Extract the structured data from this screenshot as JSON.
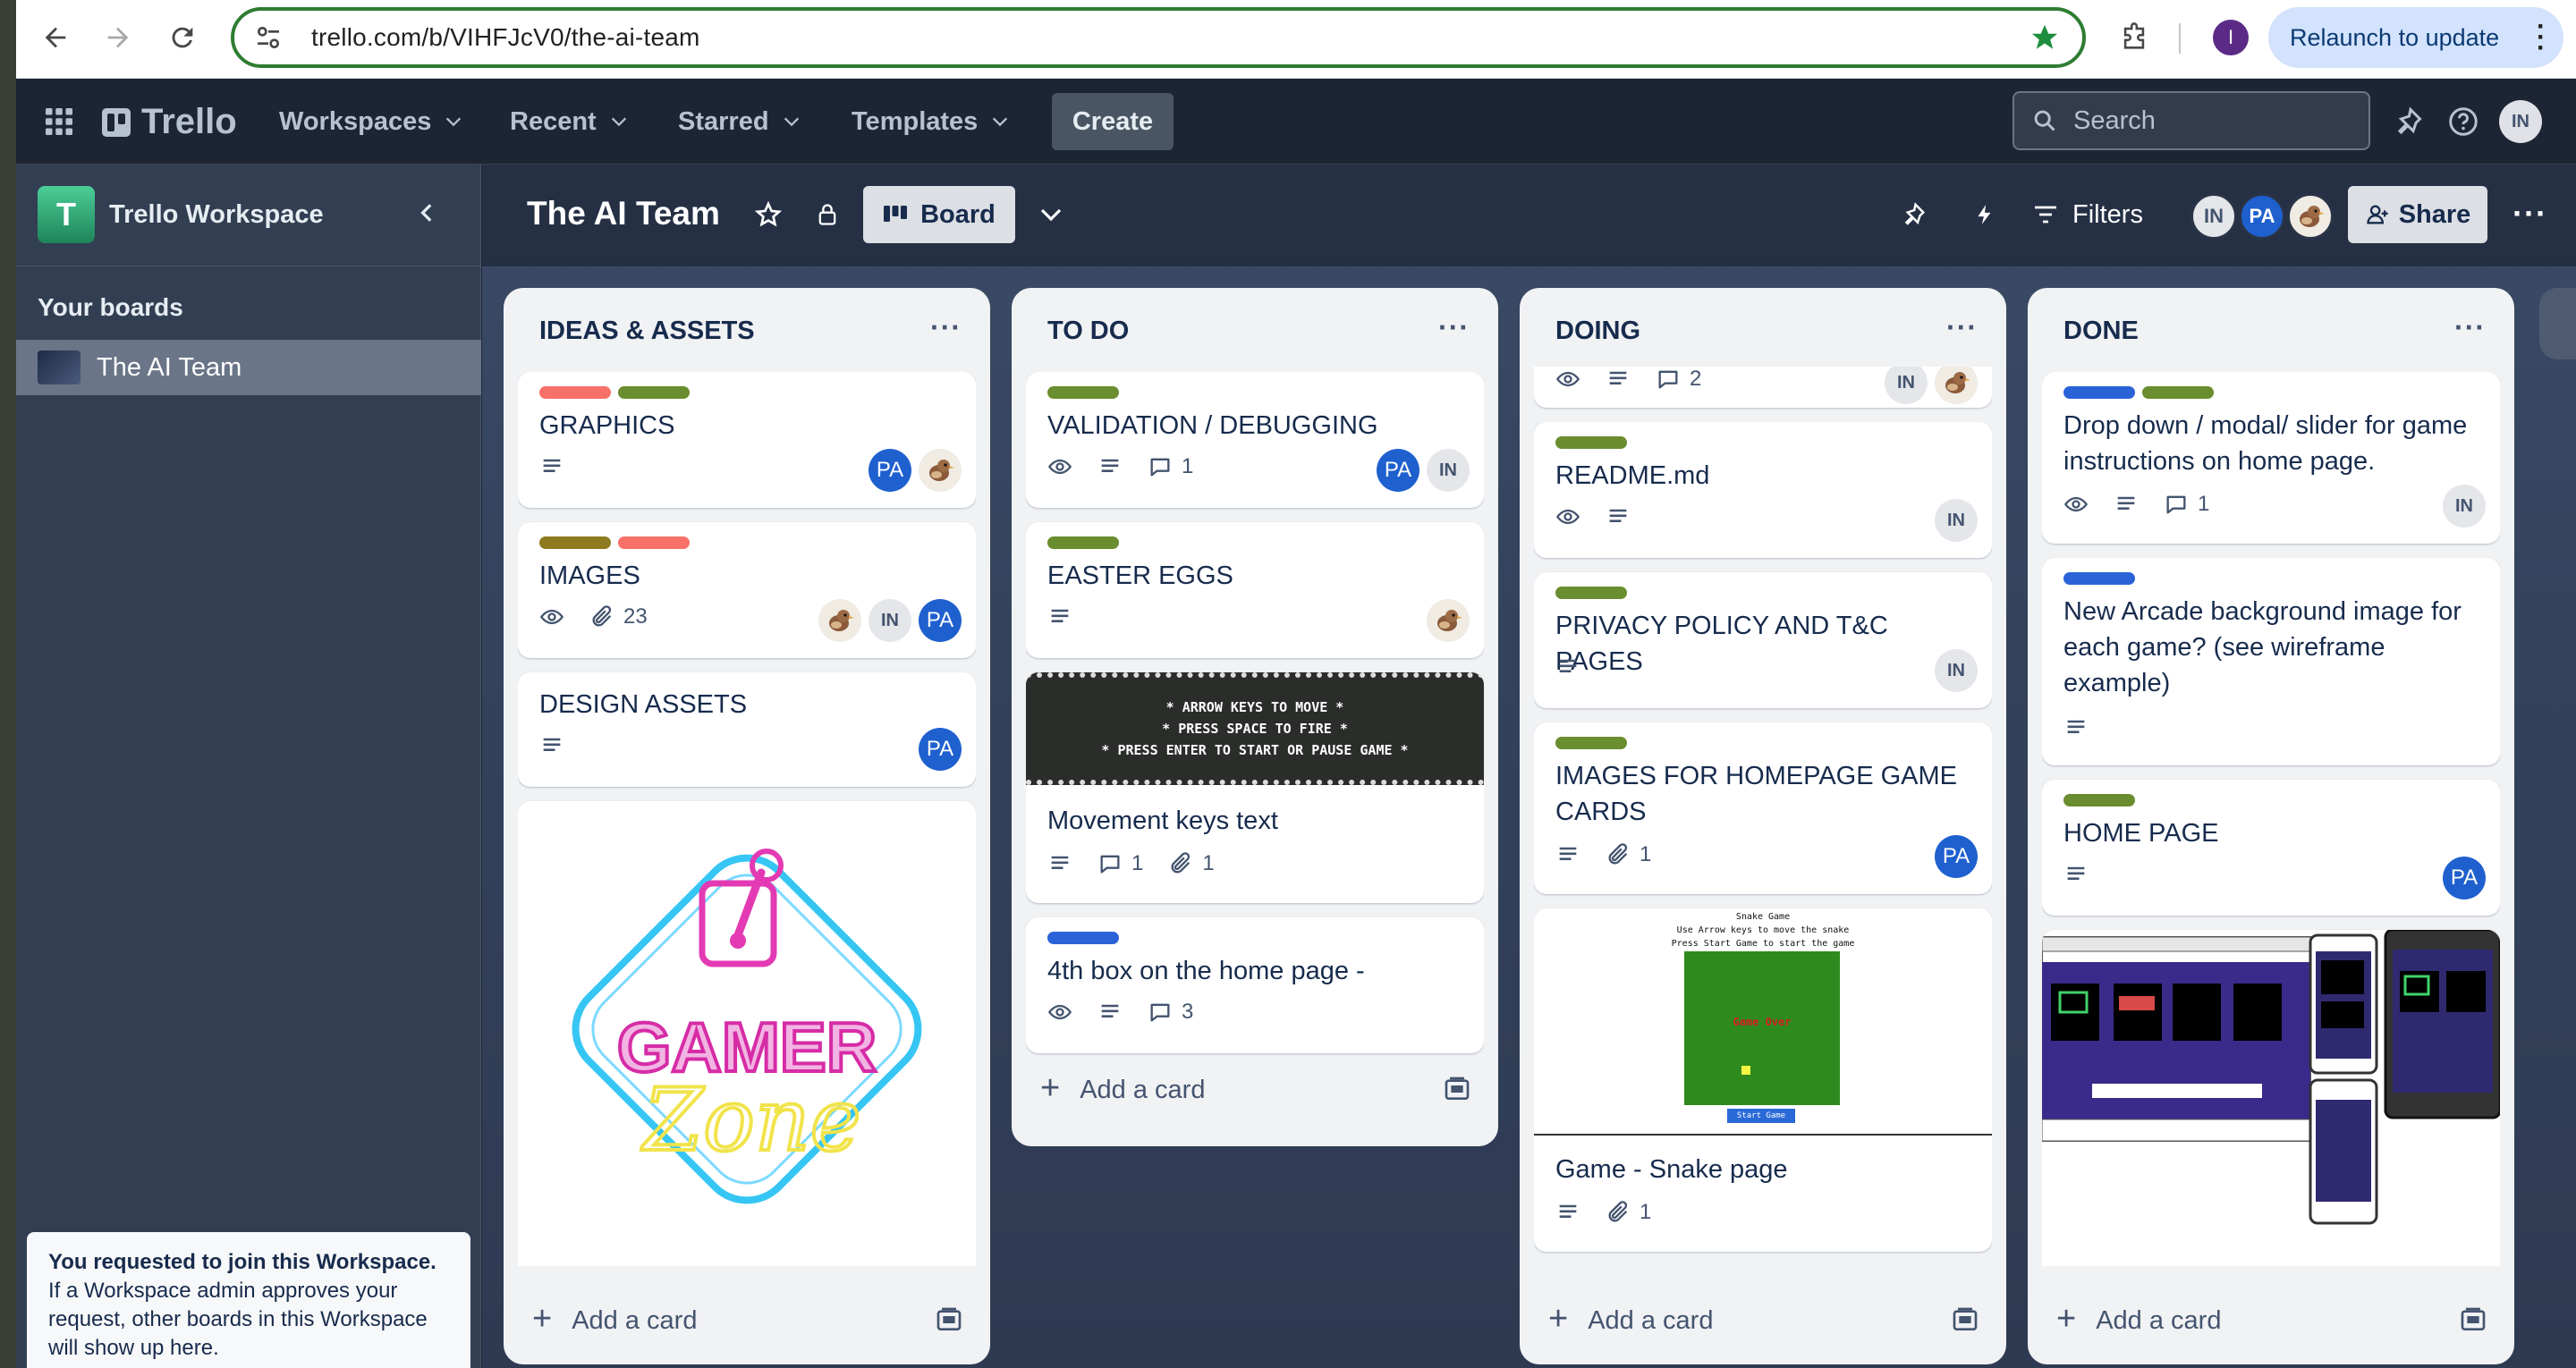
{
  "browser": {
    "url": "trello.com/b/VIHFJcV0/the-ai-team",
    "relaunch_label": "Relaunch to update",
    "profile_initial": "I"
  },
  "header": {
    "app_name": "Trello",
    "menus": [
      "Workspaces",
      "Recent",
      "Starred",
      "Templates"
    ],
    "create_label": "Create",
    "search_placeholder": "Search",
    "user_initials": "IN"
  },
  "sidebar": {
    "workspace_initial": "T",
    "workspace_name": "Trello Workspace",
    "your_boards_label": "Your boards",
    "boards": [
      "The AI Team"
    ],
    "join_note_bold": "You requested to join this Workspace.",
    "join_note_text": " If a Workspace admin approves your request, other boards in this Workspace will show up here."
  },
  "board": {
    "title": "The AI Team",
    "view_label": "Board",
    "filters_label": "Filters",
    "share_label": "Share",
    "members": [
      "IN",
      "PA"
    ]
  },
  "colors": {
    "label_red": "#f87168",
    "label_green": "#6a8d2f",
    "label_olive": "#8f7b1f",
    "label_blue": "#2a63d8",
    "avatar_pa": "#1f60cf"
  },
  "lists": [
    {
      "title": "IDEAS & ASSETS",
      "add_label": "Add a card",
      "cards": [
        {
          "title": "GRAPHICS",
          "labels": [
            "red",
            "green"
          ],
          "badges": [
            {
              "icon": "description-icon",
              "text": ""
            }
          ],
          "members": [
            "PA",
            "bird"
          ]
        },
        {
          "title": "IMAGES",
          "labels": [
            "olive",
            "red"
          ],
          "badges": [
            {
              "icon": "eye-icon",
              "text": ""
            },
            {
              "icon": "attachment-icon",
              "text": "23"
            }
          ],
          "members": [
            "bird",
            "IN",
            "PA"
          ]
        },
        {
          "title": "DESIGN ASSETS",
          "labels": [],
          "badges": [
            {
              "icon": "description-icon",
              "text": ""
            }
          ],
          "members": [
            "PA"
          ]
        },
        {
          "cover_text_1": "GAMER",
          "cover_text_2": "Zone"
        }
      ]
    },
    {
      "title": "TO DO",
      "add_label": "Add a card",
      "cards": [
        {
          "title": "VALIDATION / DEBUGGING",
          "labels": [
            "green"
          ],
          "badges": [
            {
              "icon": "eye-icon",
              "text": ""
            },
            {
              "icon": "description-icon",
              "text": ""
            },
            {
              "icon": "comment-icon",
              "text": "1"
            }
          ],
          "members": [
            "PA",
            "IN"
          ]
        },
        {
          "title": "EASTER EGGS",
          "labels": [
            "green"
          ],
          "badges": [
            {
              "icon": "description-icon",
              "text": ""
            }
          ],
          "members": [
            "bird"
          ]
        },
        {
          "title": "Movement keys text",
          "cover_lines": [
            "* ARROW KEYS TO MOVE *",
            "* PRESS SPACE TO FIRE *",
            "* PRESS ENTER TO START OR PAUSE GAME *"
          ],
          "badges": [
            {
              "icon": "description-icon",
              "text": ""
            },
            {
              "icon": "comment-icon",
              "text": "1"
            },
            {
              "icon": "attachment-icon",
              "text": "1"
            }
          ],
          "members": []
        },
        {
          "title": "4th box on the home page -",
          "labels": [
            "blue"
          ],
          "badges": [
            {
              "icon": "eye-icon",
              "text": ""
            },
            {
              "icon": "description-icon",
              "text": ""
            },
            {
              "icon": "comment-icon",
              "text": "3"
            }
          ],
          "members": []
        }
      ]
    },
    {
      "title": "DOING",
      "add_label": "Add a card",
      "cards": [
        {
          "title": "",
          "badges": [
            {
              "icon": "eye-icon",
              "text": ""
            },
            {
              "icon": "description-icon",
              "text": ""
            },
            {
              "icon": "comment-icon",
              "text": "2"
            }
          ],
          "members": [
            "IN",
            "bird"
          ]
        },
        {
          "title": "README.md",
          "labels": [
            "green"
          ],
          "badges": [
            {
              "icon": "eye-icon",
              "text": ""
            },
            {
              "icon": "description-icon",
              "text": ""
            }
          ],
          "members": [
            "IN"
          ]
        },
        {
          "title": "PRIVACY POLICY AND T&C PAGES",
          "labels": [
            "green"
          ],
          "badges": [
            {
              "icon": "description-icon",
              "text": ""
            }
          ],
          "members": [
            "IN"
          ]
        },
        {
          "title": "IMAGES FOR HOMEPAGE GAME CARDS",
          "labels": [
            "green"
          ],
          "badges": [
            {
              "icon": "description-icon",
              "text": ""
            },
            {
              "icon": "attachment-icon",
              "text": "1"
            }
          ],
          "members": [
            "PA"
          ]
        },
        {
          "title": "Game - Snake page",
          "cover_lines": [
            "Snake Game",
            "Use Arrow keys to move the snake",
            "Press Start Game to start the game"
          ],
          "cover_game_over": "Game Over",
          "cover_button": "Start Game",
          "badges": [
            {
              "icon": "description-icon",
              "text": ""
            },
            {
              "icon": "attachment-icon",
              "text": "1"
            }
          ],
          "members": []
        }
      ]
    },
    {
      "title": "DONE",
      "add_label": "Add a card",
      "cards": [
        {
          "title": "Drop down / modal/ slider for game instructions on home page.",
          "labels": [
            "blue",
            "green"
          ],
          "badges": [
            {
              "icon": "eye-icon",
              "text": ""
            },
            {
              "icon": "description-icon",
              "text": ""
            },
            {
              "icon": "comment-icon",
              "text": "1"
            }
          ],
          "members": [
            "IN"
          ]
        },
        {
          "title": "New Arcade background image for each game? (see wireframe example)",
          "labels": [
            "blue"
          ],
          "badges": [
            {
              "icon": "description-icon",
              "text": ""
            }
          ],
          "members": []
        },
        {
          "title": "HOME PAGE",
          "labels": [
            "green"
          ],
          "badges": [
            {
              "icon": "description-icon",
              "text": ""
            }
          ],
          "members": [
            "PA"
          ]
        },
        {
          "cover": "wireframe-image"
        }
      ]
    }
  ]
}
